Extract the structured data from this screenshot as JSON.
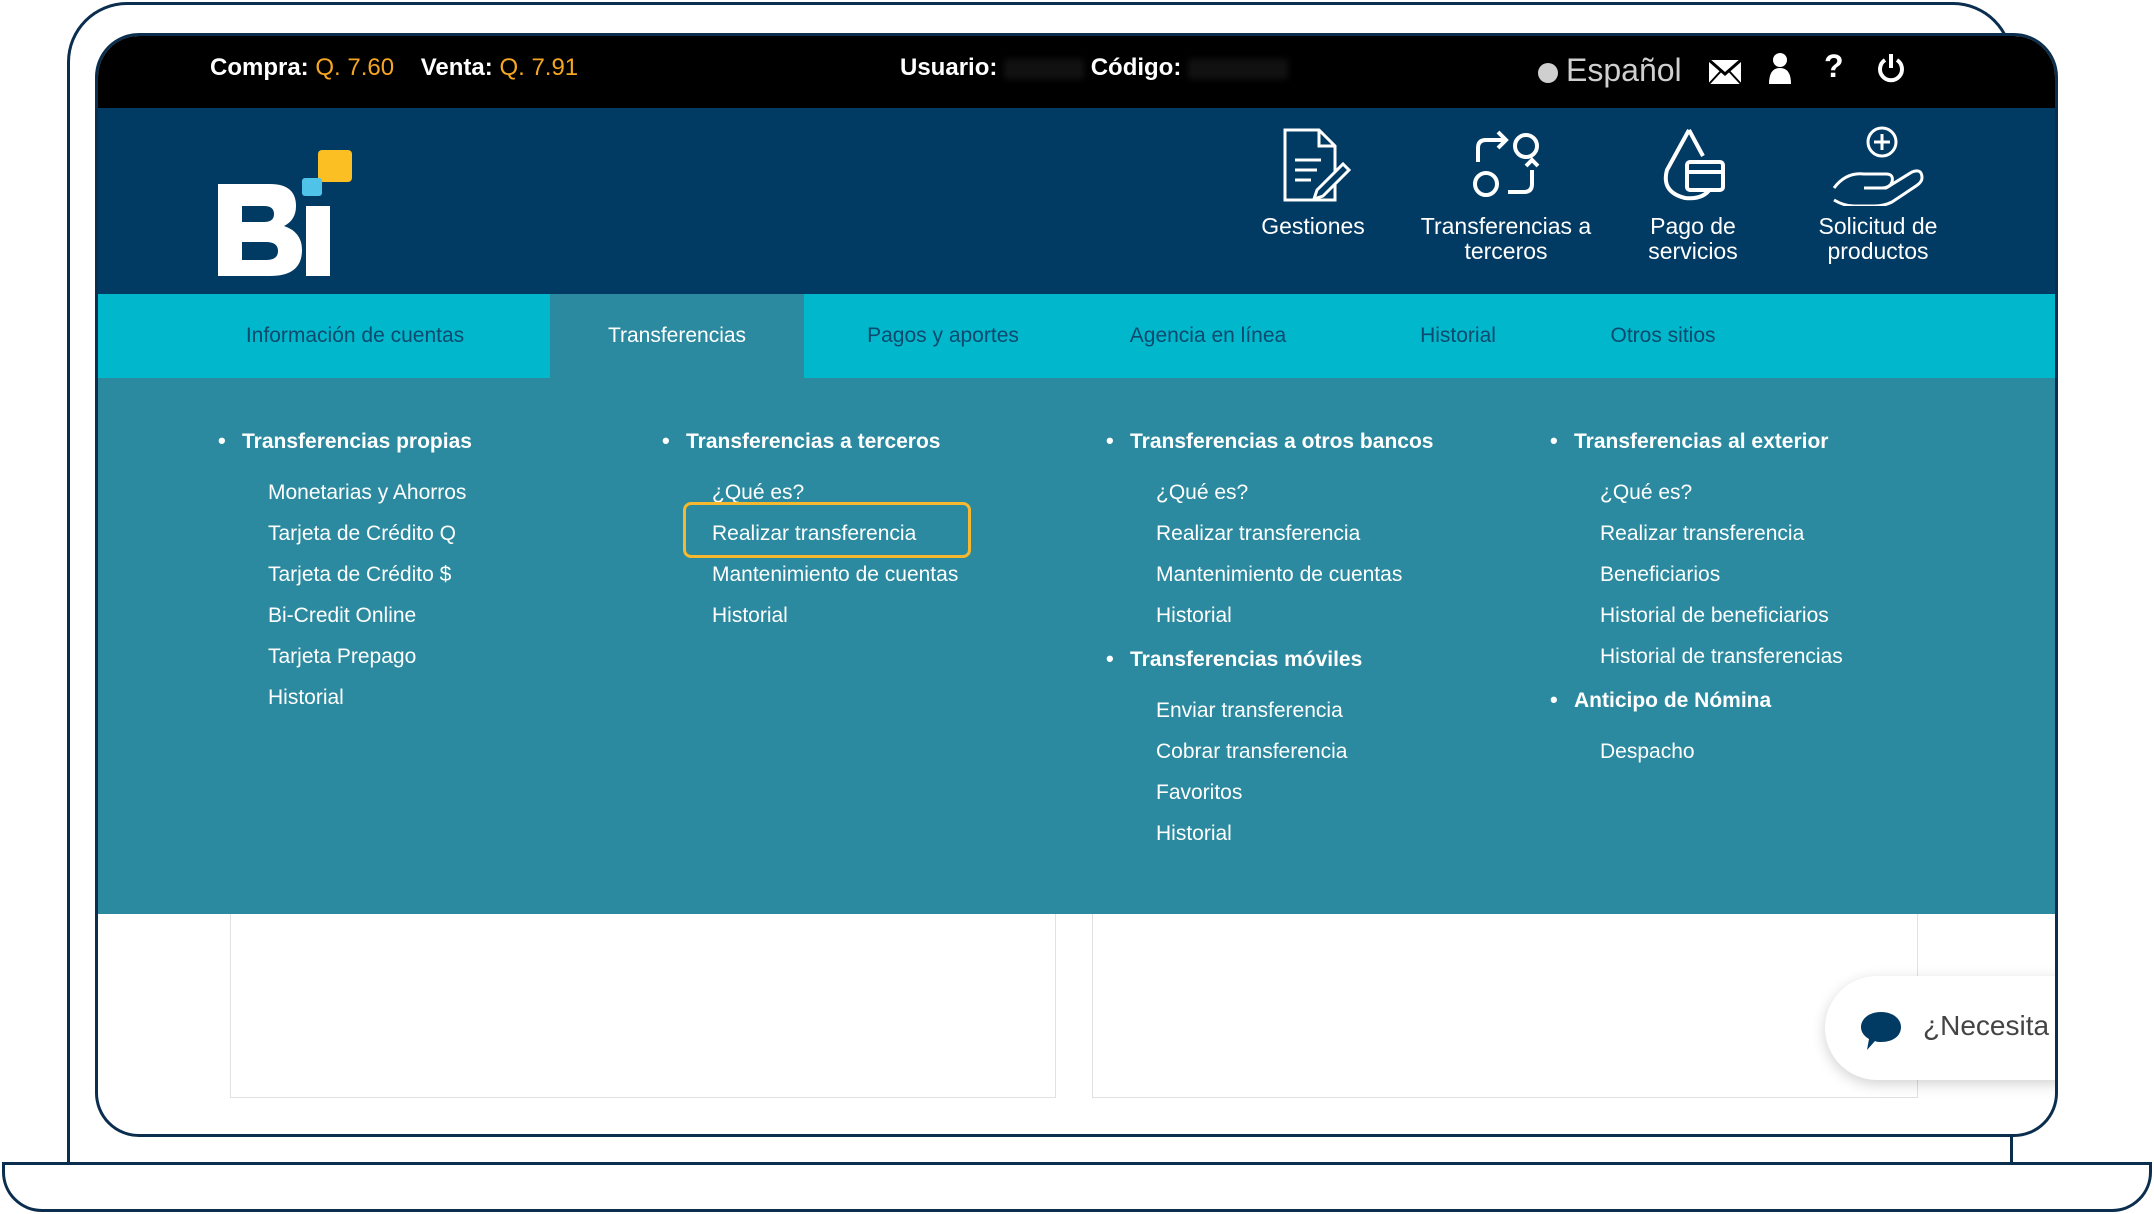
{
  "topbar": {
    "compra_label": "Compra:",
    "compra_value": "Q. 7.60",
    "venta_label": "Venta:",
    "venta_value": "Q. 7.91",
    "usuario_label": "Usuario:",
    "codigo_label": "Código:",
    "language": "Español",
    "icons": [
      "globe-icon",
      "mail-icon",
      "user-icon",
      "help-icon",
      "power-icon"
    ],
    "help_glyph": "?"
  },
  "header": {
    "logo_text": "Bi",
    "buttons": [
      {
        "label": "Gestiones",
        "icon": "document-edit-icon"
      },
      {
        "label": "Transferencias a terceros",
        "icon": "transfer-arrows-icon"
      },
      {
        "label": "Pago de servicios",
        "icon": "drop-card-icon"
      },
      {
        "label": "Solicitud de productos",
        "icon": "hand-plus-icon"
      }
    ]
  },
  "nav": {
    "tabs": [
      {
        "label": "Información de cuentas"
      },
      {
        "label": "Transferencias",
        "active": true
      },
      {
        "label": "Pagos y aportes"
      },
      {
        "label": "Agencia en línea"
      },
      {
        "label": "Historial"
      },
      {
        "label": "Otros sitios"
      }
    ]
  },
  "dropdown": {
    "col1": {
      "head": "Transferencias propias",
      "links": [
        "Monetarias y Ahorros",
        "Tarjeta de Crédito Q",
        "Tarjeta de Crédito $",
        "Bi-Credit Online",
        "Tarjeta Prepago",
        "Historial"
      ]
    },
    "col2": {
      "head": "Transferencias a terceros",
      "links": [
        "¿Qué es?",
        "Realizar transferencia",
        "Mantenimiento de cuentas",
        "Historial"
      ]
    },
    "col3": {
      "head": "Transferencias a otros bancos",
      "links": [
        "¿Qué es?",
        "Realizar transferencia",
        "Mantenimiento de cuentas",
        "Historial"
      ],
      "head2": "Transferencias móviles",
      "links2": [
        "Enviar transferencia",
        "Cobrar transferencia",
        "Favoritos",
        "Historial"
      ]
    },
    "col4": {
      "head": "Transferencias al exterior",
      "links": [
        "¿Qué es?",
        "Realizar transferencia",
        "Beneficiarios",
        "Historial de beneficiarios",
        "Historial de transferencias"
      ],
      "head2": "Anticipo de Nómina",
      "links2": [
        "Despacho"
      ]
    }
  },
  "chat": {
    "label": "¿Necesita"
  },
  "colors": {
    "topbar": "#000000",
    "header": "#013a63",
    "navbar": "#00b7cc",
    "dropdown": "#2b8a9f",
    "accent": "#f5a623",
    "highlight": "#f5b82e"
  }
}
